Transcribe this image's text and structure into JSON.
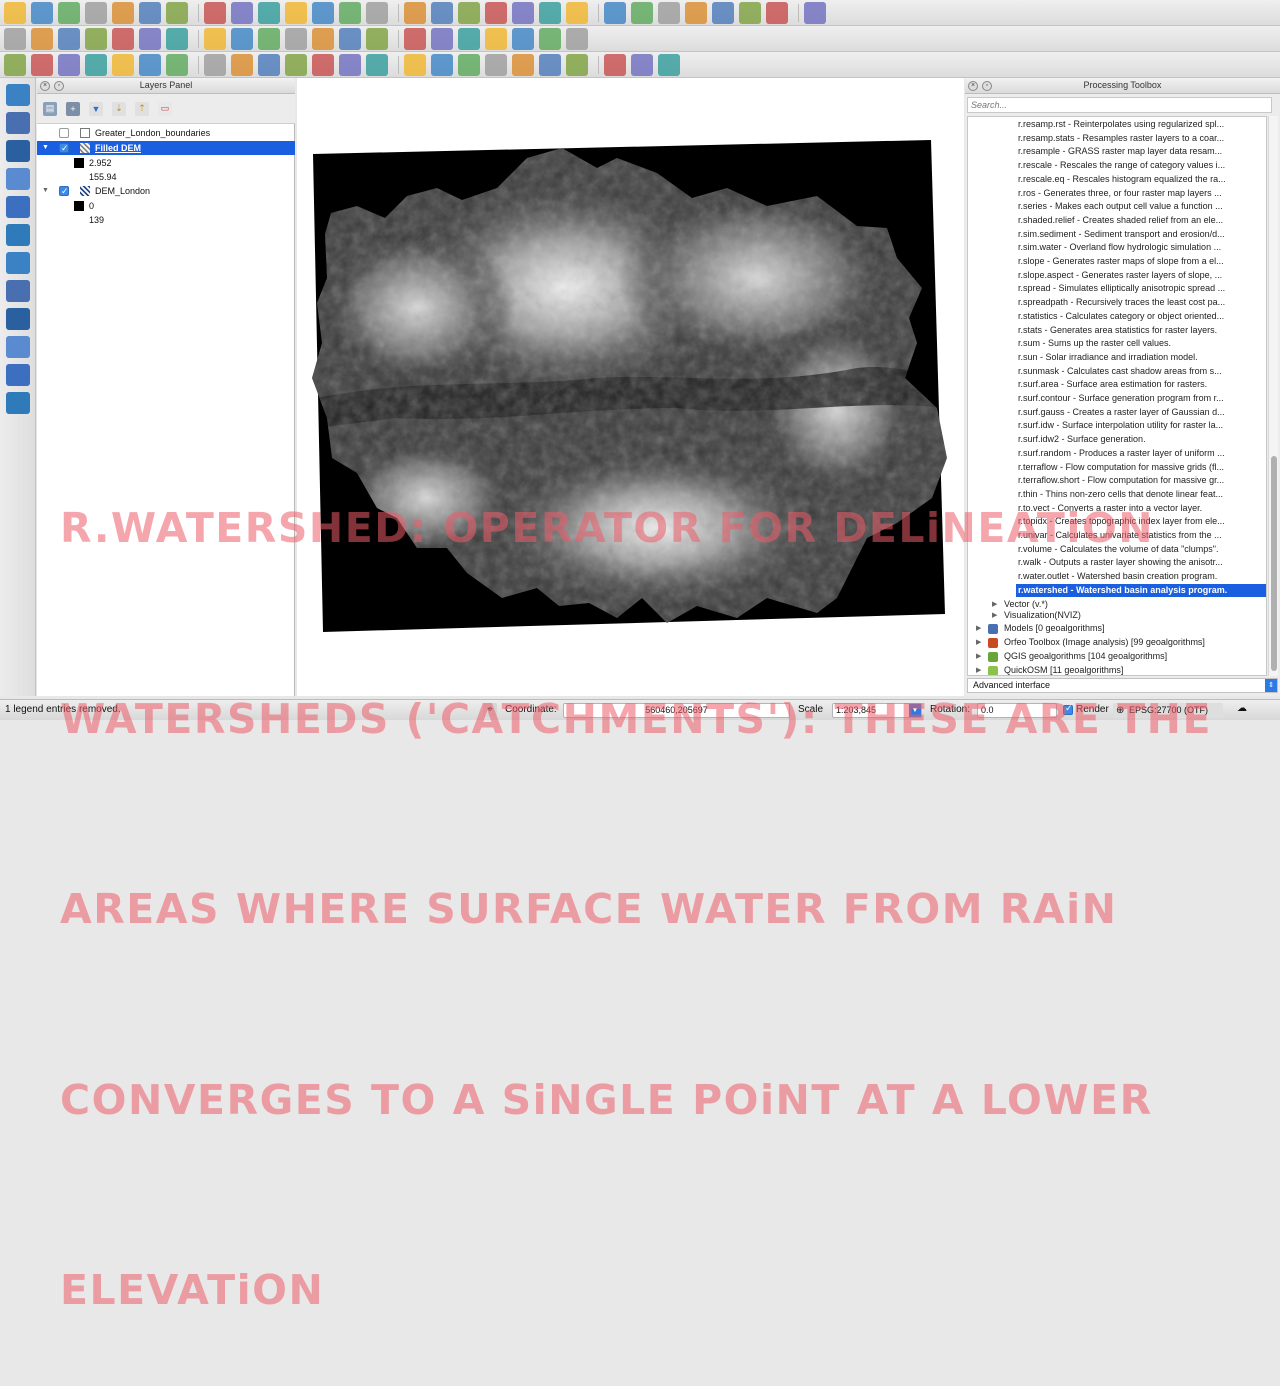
{
  "toolbar_rows": [
    {
      "name": "file-toolbar",
      "icons": [
        "new-project-icon",
        "open-project-icon",
        "save-project-icon",
        "save-as-icon",
        "new-print-composer-icon",
        "composer-manager-icon",
        "pan-icon",
        "pan-to-selection-icon",
        "zoom-in-icon",
        "zoom-out-icon",
        "zoom-native-icon",
        "zoom-full-icon",
        "zoom-to-selection-icon",
        "zoom-to-layer-icon",
        "zoom-last-icon",
        "zoom-next-icon",
        "refresh-icon",
        "identify-icon",
        "select-features-icon",
        "deselect-icon",
        "field-calculator-icon",
        "attribute-table-icon",
        "statistics-icon",
        "measure-icon",
        "map-tips-icon",
        "bookmark-icon",
        "text-annotation-icon",
        "help-icon",
        "whats-this-icon"
      ]
    },
    {
      "name": "edit-toolbar",
      "icons": [
        "current-edits-icon",
        "toggle-editing-icon",
        "save-edits-icon",
        "add-feature-icon",
        "move-feature-icon",
        "node-tool-icon",
        "delete-selected-icon",
        "cut-features-icon",
        "copy-features-icon",
        "paste-features-icon",
        "xy-coordinates-icon",
        "label-icon",
        "label-pin-icon",
        "label-highlight-icon",
        "label-show-hide-icon",
        "label-move-icon",
        "label-rotate-icon",
        "label-change-icon",
        "csv-icon",
        "python-console-icon",
        "plugins-grid-icon"
      ]
    },
    {
      "name": "advanced-edit-toolbar",
      "icons": [
        "georeferencer-icon",
        "undo-icon",
        "redo-icon",
        "rotate-point-symbols-icon",
        "simplify-feature-icon",
        "add-ring-icon",
        "add-part-icon",
        "fill-ring-icon",
        "delete-ring-icon",
        "delete-part-icon",
        "reshape-features-icon",
        "offset-curve-icon",
        "split-features-icon",
        "split-parts-icon",
        "merge-features-icon",
        "merge-attributes-icon",
        "rotate-feature-icon",
        "refresh-circle-icon",
        "terrain-green-icon",
        "layer-green-icon",
        "house-icon",
        "runner-icon",
        "camera-icon",
        "plugin-icon"
      ]
    }
  ],
  "left_toolbar_icons": [
    "add-vector-layer-icon",
    "add-raster-layer-icon",
    "add-postgis-layer-icon",
    "add-spatialite-layer-icon",
    "add-mssql-layer-icon",
    "add-wms-layer-icon",
    "add-wcs-layer-icon",
    "add-wfs-layer-icon",
    "add-delimited-text-icon",
    "new-vector-layer-icon",
    "gps-tools-icon",
    "pointer-arrow-icon"
  ],
  "layers_panel": {
    "title": "Layers Panel",
    "layers": [
      {
        "name": "Greater_London_boundaries",
        "checked": false,
        "selected": false,
        "expanded": false
      },
      {
        "name": "Filled DEM",
        "checked": true,
        "selected": true,
        "expanded": true,
        "legend": [
          "2.952",
          "155.94"
        ]
      },
      {
        "name": "DEM_London",
        "checked": true,
        "selected": false,
        "expanded": true,
        "legend": [
          "0",
          "139"
        ]
      }
    ]
  },
  "toolbox": {
    "title": "Processing Toolbox",
    "search_placeholder": "Search...",
    "algorithms": [
      "r.resamp.rst - Reinterpolates using regularized spl...",
      "r.resamp.stats - Resamples raster layers to a coar...",
      "r.resample - GRASS raster map layer data resam...",
      "r.rescale - Rescales the range of category values i...",
      "r.rescale.eq - Rescales histogram equalized the ra...",
      "r.ros - Generates three, or four raster map layers ...",
      "r.series - Makes each output cell value a function ...",
      "r.shaded.relief - Creates shaded relief from an ele...",
      "r.sim.sediment - Sediment transport and erosion/d...",
      "r.sim.water - Overland flow hydrologic simulation ...",
      "r.slope - Generates raster maps of slope from a el...",
      "r.slope.aspect - Generates raster layers of slope, ...",
      "r.spread - Simulates elliptically anisotropic spread ...",
      "r.spreadpath - Recursively traces the least cost pa...",
      "r.statistics - Calculates category or object oriented...",
      "r.stats - Generates area statistics for raster layers.",
      "r.sum - Sums up the raster cell values.",
      "r.sun - Solar irradiance and irradiation model.",
      "r.sunmask - Calculates cast shadow areas from s...",
      "r.surf.area - Surface area estimation for rasters.",
      "r.surf.contour - Surface generation program from r...",
      "r.surf.gauss - Creates a raster layer of Gaussian d...",
      "r.surf.idw - Surface interpolation utility for raster la...",
      "r.surf.idw2 - Surface generation.",
      "r.surf.random - Produces a raster layer of uniform ...",
      "r.terraflow - Flow computation for massive grids (fl...",
      "r.terraflow.short - Flow computation for massive gr...",
      "r.thin - Thins non-zero cells that denote linear feat...",
      "r.to.vect - Converts a raster into a vector layer.",
      "r.topidx - Creates topographic index layer from ele...",
      "r.univar - Calculates univariate statistics from the ...",
      "r.volume - Calculates the volume of data \"clumps\".",
      "r.walk - Outputs a raster layer showing the anisotr...",
      "r.water.outlet - Watershed basin creation program.",
      "r.watershed - Watershed basin analysis program."
    ],
    "selected_algorithm": "r.watershed - Watershed basin analysis program.",
    "subgroups": [
      "Vector (v.*)",
      "Visualization(NVIZ)"
    ],
    "providers": [
      "Models [0 geoalgorithms]",
      "Orfeo Toolbox (Image analysis) [99 geoalgorithms]",
      "QGIS geoalgorithms [104 geoalgorithms]",
      "QuickOSM [11 geoalgorithms]"
    ],
    "interface_mode": "Advanced interface"
  },
  "status_bar": {
    "message": "1 legend entries removed.",
    "coordinate_label": "Coordinate:",
    "coordinate_value": "560460,205697",
    "scale_label": "Scale",
    "scale_value": "1:203,845",
    "rotation_label": "Rotation:",
    "rotation_value": "0.0",
    "render_label": "Render",
    "crs": "EPSG:27700 (OTF)"
  },
  "overlay_caption": {
    "lines": [
      "R.WATERSHED: OPERATOR FOR DELiNEATiON",
      "WATERSHEDS ('CATCHMENTS'): THESE ARE THE",
      "AREAS WHERE SURFACE WATER FROM RAiN",
      "CONVERGES TO A SiNGLE POiNT AT A LOWER",
      "ELEVATiON"
    ]
  },
  "colors": {
    "selection": "#1a5fe0",
    "caption": "#ec5c68"
  }
}
